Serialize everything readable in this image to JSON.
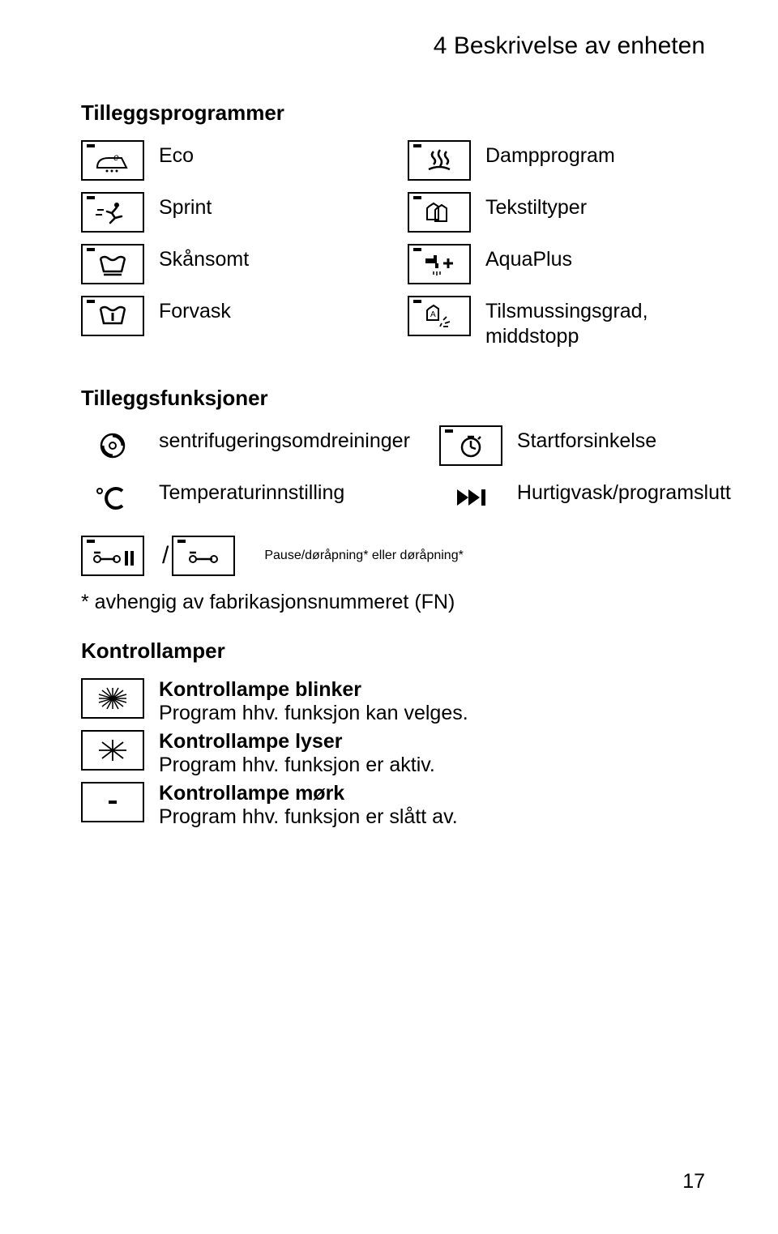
{
  "chapter_title": "4 Beskrivelse av enheten",
  "sections": {
    "additional_programs": "Tilleggsprogrammer",
    "additional_functions": "Tilleggsfunksjoner",
    "indicator_lights": "Kontrollamper"
  },
  "programs": {
    "left": [
      {
        "key": "eco",
        "label": "Eco"
      },
      {
        "key": "sprint",
        "label": "Sprint"
      },
      {
        "key": "gentle",
        "label": "Skånsomt"
      },
      {
        "key": "prewash",
        "label": "Forvask"
      }
    ],
    "right": [
      {
        "key": "steam",
        "label": "Dampprogram"
      },
      {
        "key": "textiles",
        "label": "Tekstiltyper"
      },
      {
        "key": "aquaplus",
        "label": "AquaPlus"
      },
      {
        "key": "soiling",
        "label": "Tilsmussingsgrad, middstopp"
      }
    ]
  },
  "functions": {
    "left": [
      {
        "key": "spin",
        "label": "sentrifugeringsomdreininger"
      },
      {
        "key": "temp",
        "label": "Temperaturinnstilling"
      }
    ],
    "right": [
      {
        "key": "delay",
        "label": "Startforsinkelse"
      },
      {
        "key": "quick",
        "label": "Hurtigvask/programslutt"
      }
    ],
    "pause_label": "Pause/døråpning* eller døråpning*"
  },
  "footnote": "* avhengig av fabrikasjonsnummeret (FN)",
  "lamps": [
    {
      "key": "blink",
      "label": "Kontrollampe blinker",
      "desc": "Program hhv. funksjon kan velges."
    },
    {
      "key": "on",
      "label": "Kontrollampe lyser",
      "desc": "Program hhv. funksjon er aktiv."
    },
    {
      "key": "off",
      "label": "Kontrollampe mørk",
      "desc": "Program hhv. funksjon er slått av."
    }
  ],
  "page_number": "17"
}
